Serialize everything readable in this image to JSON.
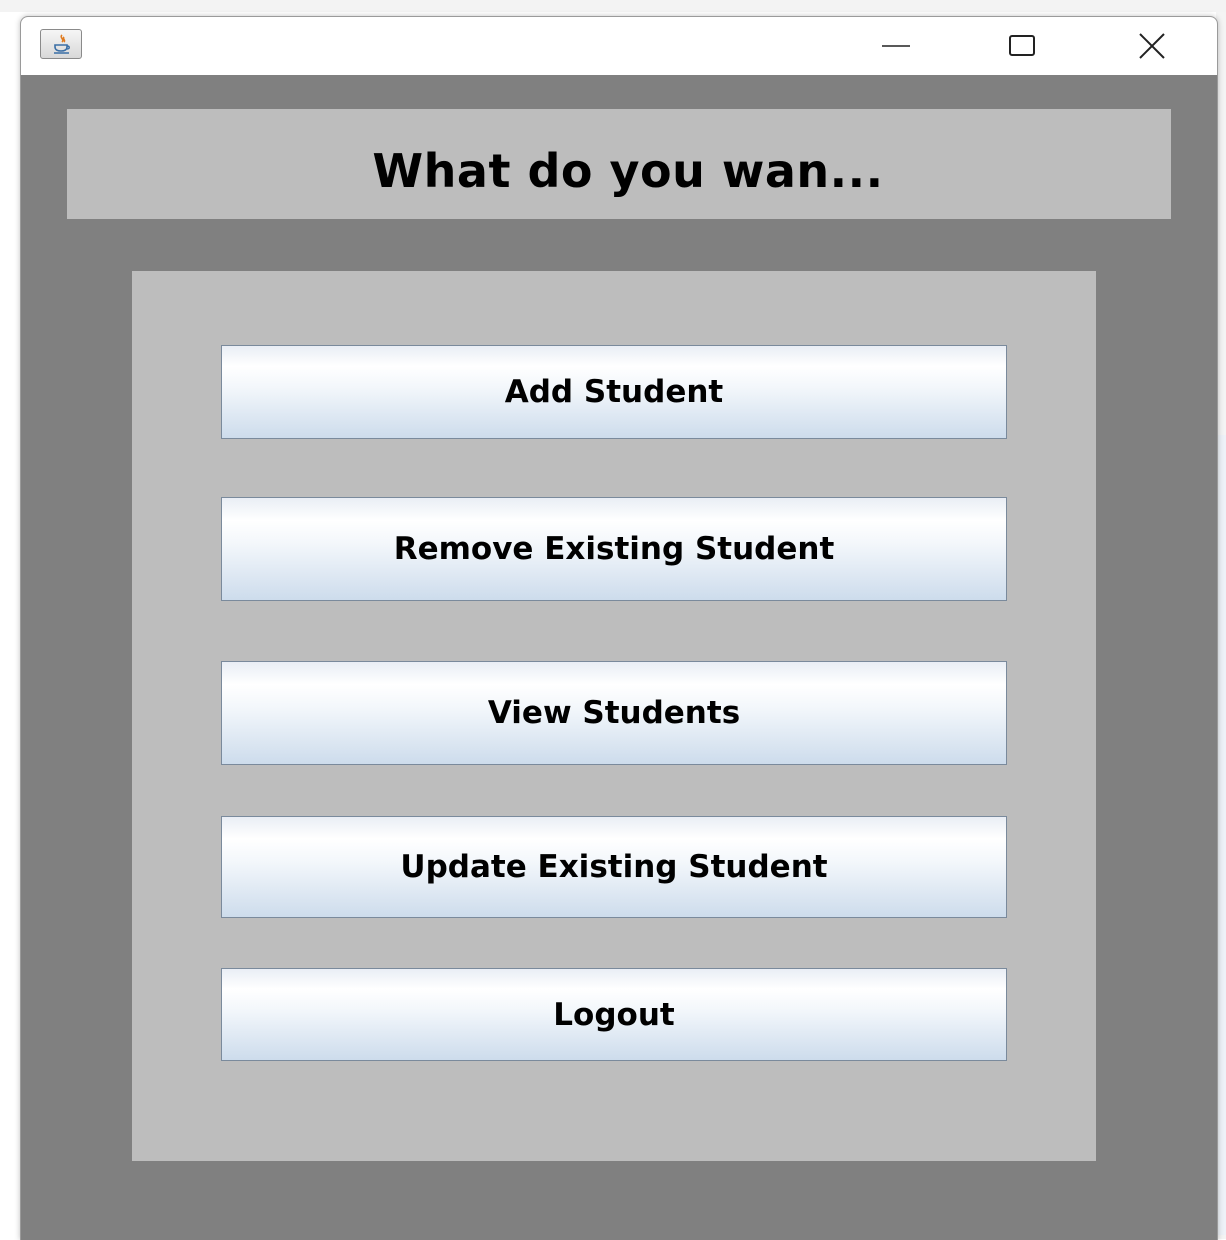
{
  "window": {
    "app_icon": "java-coffee-cup-icon",
    "controls": {
      "minimize_icon": "minimize-icon",
      "maximize_icon": "maximize-icon",
      "close_icon": "close-icon"
    }
  },
  "header": {
    "title": "What do you wan..."
  },
  "menu": {
    "buttons": [
      {
        "label": "Add Student"
      },
      {
        "label": "Remove Existing Student"
      },
      {
        "label": "View Students"
      },
      {
        "label": "Update Existing Student"
      },
      {
        "label": "Logout"
      }
    ]
  },
  "colors": {
    "window_background": "#808080",
    "panel_background": "#bdbdbd",
    "button_gradient_top": "#ffffff",
    "button_gradient_bottom": "#cddcec",
    "button_border": "#7a8a9c"
  }
}
